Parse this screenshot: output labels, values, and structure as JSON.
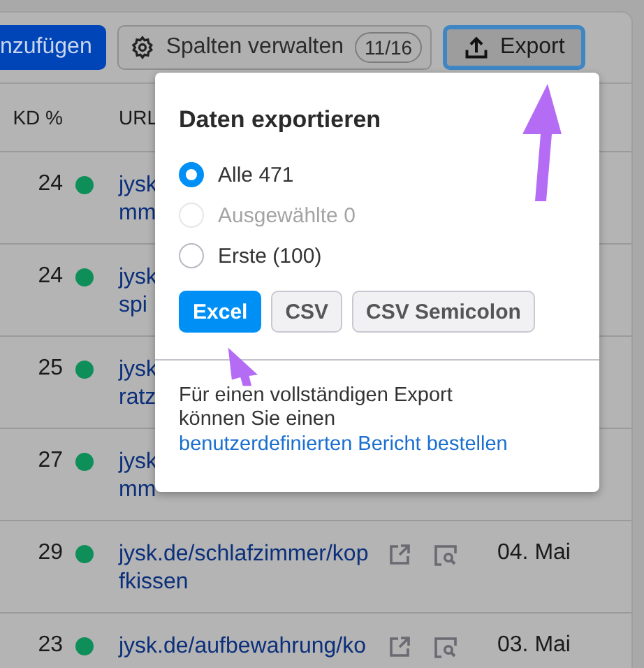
{
  "toolbar": {
    "add_button": "nzufügen",
    "columns_button": {
      "label": "Spalten verwalten",
      "badge": "11/16"
    },
    "export_button": {
      "label": "Export",
      "focused": true
    }
  },
  "table": {
    "columns": [
      "KD %",
      "URL"
    ],
    "rows": [
      {
        "kd": "24",
        "url_lines": [
          "jysk",
          "mm"
        ]
      },
      {
        "kd": "24",
        "url_lines": [
          "jysk",
          "spi"
        ]
      },
      {
        "kd": "25",
        "url_lines": [
          "jysk",
          "ratz"
        ]
      },
      {
        "kd": "27",
        "url_lines": [
          "jysk",
          "mm"
        ]
      },
      {
        "kd": "29",
        "url_lines": [
          "jysk.de/schlafzimmer/kop",
          "fkissen"
        ],
        "date": "04. Mai"
      },
      {
        "kd": "23",
        "url_lines": [
          "jysk.de/aufbewahrung/ko"
        ],
        "date": "03. Mai"
      }
    ]
  },
  "export_popup": {
    "title": "Daten exportieren",
    "options": [
      {
        "label": "Alle",
        "count": "471",
        "selected": true,
        "disabled": false
      },
      {
        "label": "Ausgewählte",
        "count": "0",
        "selected": false,
        "disabled": true
      },
      {
        "label": "Erste (100)",
        "selected": false,
        "disabled": false
      }
    ],
    "formats": [
      {
        "label": "Excel",
        "selected": true
      },
      {
        "label": "CSV",
        "selected": false
      },
      {
        "label": "CSV Semicolon",
        "selected": false
      }
    ],
    "note": "Für einen vollständigen Export können Sie einen",
    "link": "benutzerdefinierten Bericht bestellen"
  }
}
